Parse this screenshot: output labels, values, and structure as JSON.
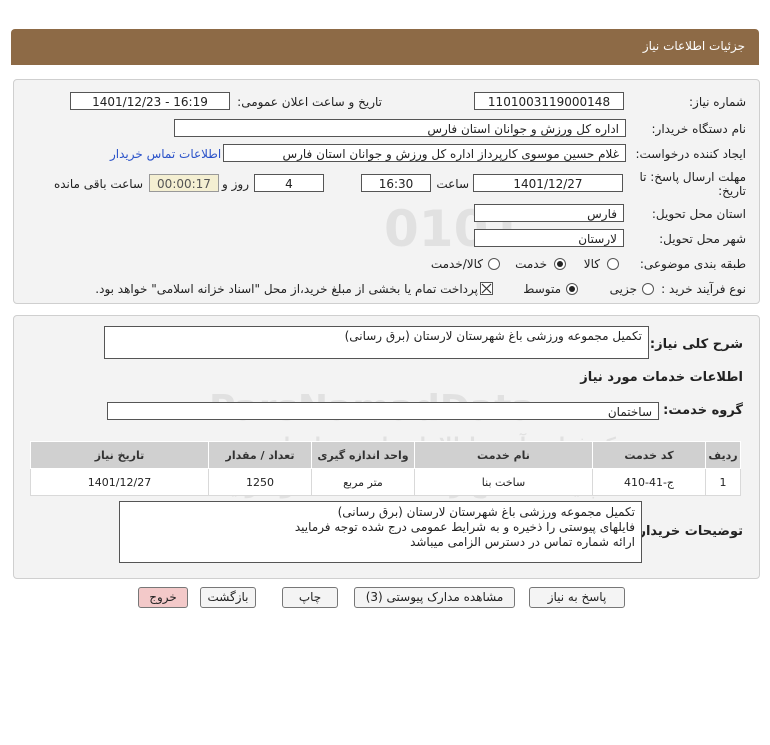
{
  "header": {
    "title": "جزئیات اطلاعات نیاز"
  },
  "form": {
    "need_number_label": "شماره نیاز:",
    "need_number": "1101003119000148",
    "announce_label": "تاریخ و ساعت اعلان عمومی:",
    "announce_value": "1401/12/23 - 16:19",
    "buyer_org_label": "نام دستگاه خریدار:",
    "buyer_org": "اداره کل ورزش و جوانان استان فارس",
    "requester_label": "ایجاد کننده درخواست:",
    "requester": "غلام حسین موسوی کارپرداز اداره کل ورزش و جوانان استان فارس",
    "contact_link": "اطلاعات تماس خریدار",
    "deadline_label_1": "مهلت ارسال پاسخ: تا",
    "deadline_label_2": "تاریخ:",
    "deadline_date": "1401/12/27",
    "time_label": "ساعت",
    "deadline_time": "16:30",
    "days_value": "4",
    "days_label": "روز و",
    "remaining_time": "00:00:17",
    "remaining_label": "ساعت باقی مانده",
    "province_label": "استان محل تحویل:",
    "province": "فارس",
    "city_label": "شهر محل تحویل:",
    "city": "لارستان",
    "category_label": "طبقه بندی موضوعی:",
    "category_options": [
      "کالا",
      "خدمت",
      "کالا/خدمت"
    ],
    "category_selected": "خدمت",
    "process_label": "نوع فرآیند خرید :",
    "process_options": [
      "جزیی",
      "متوسط"
    ],
    "process_selected": "متوسط",
    "payment_note": "پرداخت تمام یا بخشی از مبلغ خرید،از محل \"اسناد خزانه اسلامی\" خواهد بود."
  },
  "need": {
    "summary_label": "شرح کلی نیاز:",
    "summary": "تکمیل مجموعه ورزشی باغ شهرستان لارستان (برق رسانی)",
    "services_title": "اطلاعات خدمات مورد نیاز",
    "service_group_label": "گروه خدمت:",
    "service_group": "ساختمان"
  },
  "table": {
    "headers": [
      "ردیف",
      "کد خدمت",
      "نام خدمت",
      "واحد اندازه گیری",
      "تعداد / مقدار",
      "تاریخ نیاز"
    ],
    "rows": [
      {
        "row": "1",
        "code": "ج-41-410",
        "name": "ساخت بنا",
        "unit": "متر مربع",
        "qty": "1250",
        "date": "1401/12/27"
      }
    ]
  },
  "buyer_notes": {
    "label": "توضیحات خریدار:",
    "line1": "تکمیل مجموعه ورزشی باغ شهرستان لارستان (برق رسانی)",
    "line2": "فایلهای پیوستی را ذخیره و به شرایط عمومی درج شده توجه فرمایید",
    "line3": "ارائه شماره تماس در دسترس الزامی میباشد"
  },
  "buttons": {
    "reply": "پاسخ به نیاز",
    "attachments": "مشاهده مدارک پیوستی (3)",
    "print": "چاپ",
    "back": "بازگشت",
    "exit": "خروج"
  },
  "watermark": {
    "brand": "ParsNamadData",
    "tagline": "مرکز فراهم آوری اطلاعات پارس نماد داده",
    "subtitle": "پایگاه اطلاع رسانی مناقصه و مزایده",
    "digits": "0101"
  },
  "colors": {
    "header_bg": "#8d6a46",
    "link": "#2a52c9",
    "exit_button": "#f3c9c9"
  }
}
